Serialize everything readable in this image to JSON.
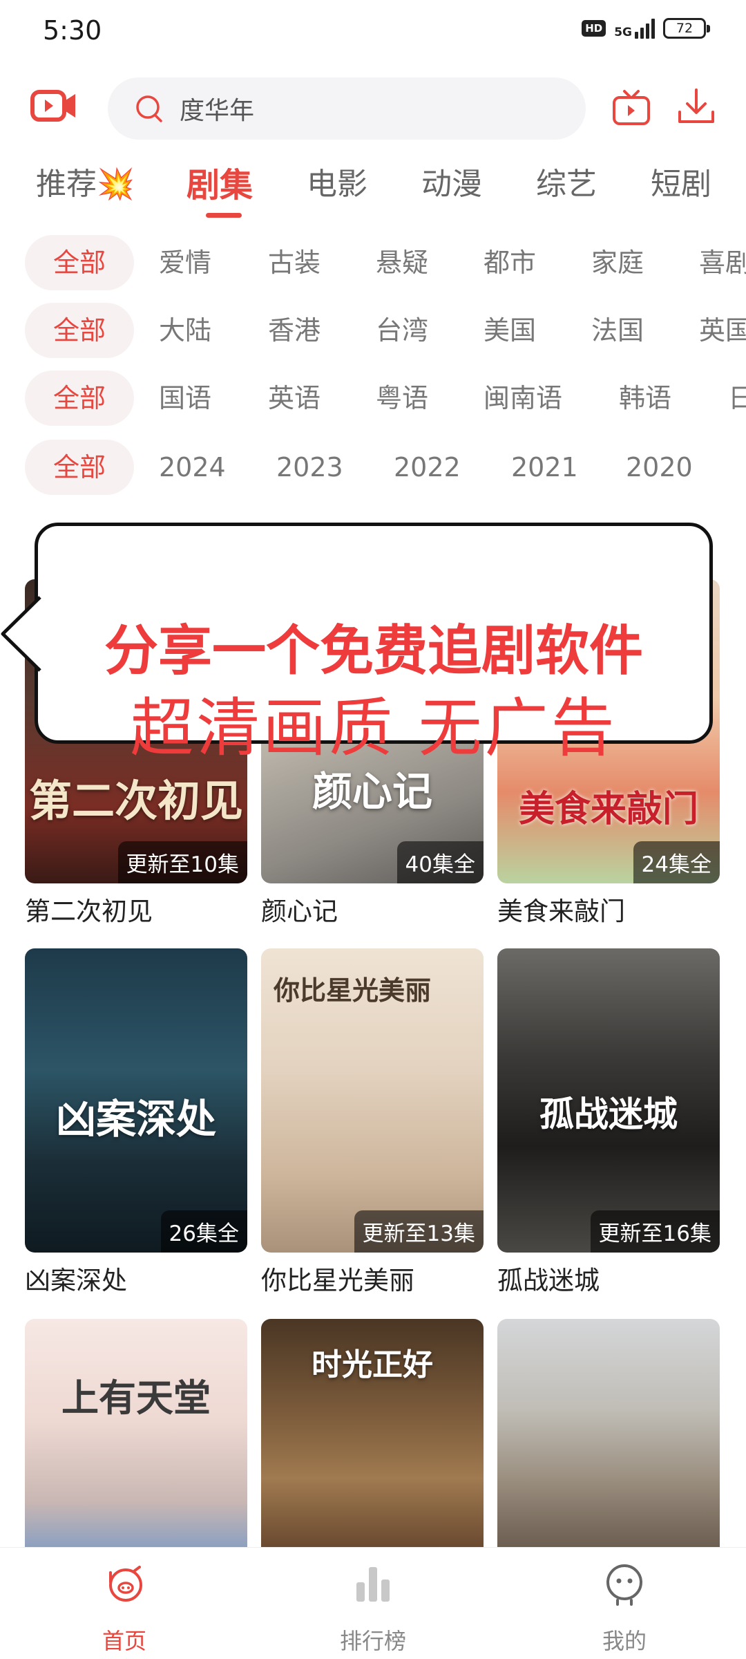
{
  "status_bar": {
    "time": "5:30",
    "hd_label": "HD",
    "network_label": "5G",
    "battery": "72"
  },
  "search": {
    "query": "度华年"
  },
  "tabs": [
    {
      "label": "推荐"
    },
    {
      "label": "剧集"
    },
    {
      "label": "电影"
    },
    {
      "label": "动漫"
    },
    {
      "label": "综艺"
    },
    {
      "label": "短剧"
    }
  ],
  "active_tab": "剧集",
  "filters": {
    "all_label": "全部",
    "genre": [
      "爱情",
      "古装",
      "悬疑",
      "都市",
      "家庭",
      "喜剧"
    ],
    "region": [
      "大陆",
      "香港",
      "台湾",
      "美国",
      "法国",
      "英国"
    ],
    "language": [
      "国语",
      "英语",
      "粤语",
      "闽南语",
      "韩语",
      "日语"
    ],
    "year": [
      "2024",
      "2023",
      "2022",
      "2021",
      "2020"
    ]
  },
  "callout": {
    "line1": "分享一个免费追剧软件",
    "line2": "超清画质 无广告"
  },
  "shows": [
    {
      "title": "第二次初见",
      "badge": "更新至10集",
      "poster_text": "第二次初见"
    },
    {
      "title": "颜心记",
      "badge": "40集全",
      "poster_text": "颜心记"
    },
    {
      "title": "美食来敲门",
      "badge": "24集全",
      "poster_text": "美食来敲门"
    },
    {
      "title": "凶案深处",
      "badge": "26集全",
      "poster_text": "凶案深处"
    },
    {
      "title": "你比星光美丽",
      "badge": "更新至13集",
      "poster_text": "你比星光美丽"
    },
    {
      "title": "孤战迷城",
      "badge": "更新至16集",
      "poster_text": "孤战迷城"
    }
  ],
  "partial_posters": [
    {
      "poster_text": "上有天堂"
    },
    {
      "poster_text": "时光正好"
    },
    {
      "poster_text": ""
    }
  ],
  "bottom_nav": [
    {
      "label": "首页"
    },
    {
      "label": "排行榜"
    },
    {
      "label": "我的"
    }
  ],
  "colors": {
    "accent": "#e8473f",
    "callout_text": "#ee3b3b"
  }
}
